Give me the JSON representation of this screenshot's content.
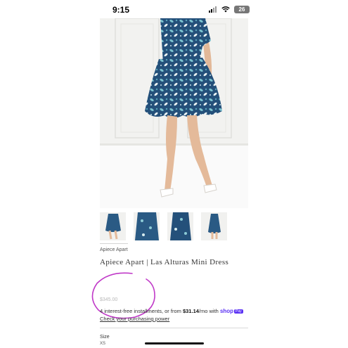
{
  "status_bar": {
    "time": "9:15",
    "battery": "26"
  },
  "product": {
    "brand": "Apiece Apart",
    "title": "Apiece Apart | Las Alturas Mini Dress",
    "price": "$345.00",
    "installments_text": "4 interest-free installments, or from ",
    "installment_amount": "$31.14",
    "installment_suffix": "/mo with ",
    "pay_brand": "shop",
    "pay_badge": "Pay",
    "check_link": "Check your purchasing power",
    "size_label": "Size",
    "size_value": "XS"
  },
  "thumbnails": [
    {
      "name": "thumbnail-1"
    },
    {
      "name": "thumbnail-2"
    },
    {
      "name": "thumbnail-3"
    },
    {
      "name": "thumbnail-4"
    }
  ],
  "colors": {
    "dress_navy": "#24507a",
    "dress_teal": "#6fb6c6",
    "annotation_circle": "#c03ac8",
    "shop_pay": "#5a31f4"
  }
}
